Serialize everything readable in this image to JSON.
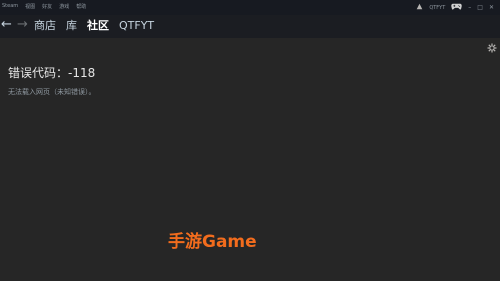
{
  "menubar": {
    "items": [
      "Steam",
      "视图",
      "好友",
      "游戏",
      "帮助"
    ],
    "account_name": "QTFYT"
  },
  "navbar": {
    "back_arrow": "←",
    "forward_arrow": "→",
    "tabs": [
      "商店",
      "库",
      "社区",
      "QTFYT"
    ],
    "active_tab": "社区"
  },
  "content": {
    "error_title": "错误代码：-118",
    "error_description": "无法载入网页（未知错误）。"
  },
  "watermark": "手游Game",
  "icons": {
    "notification": "broadcast-icon",
    "controller": "gamepad-icon",
    "settings": "gear-icon"
  },
  "colors": {
    "background": "#262626",
    "menubar": "#171a21",
    "watermark": "#f26c1d"
  }
}
